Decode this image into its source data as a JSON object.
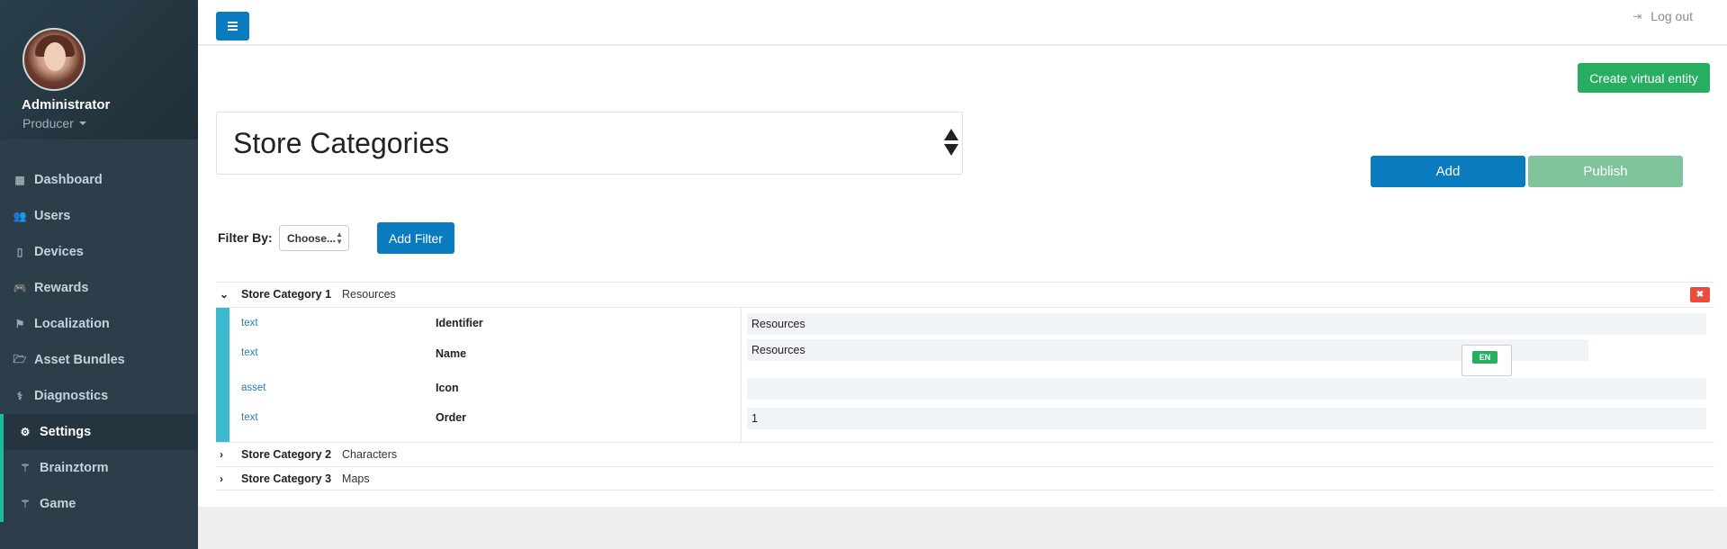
{
  "user": {
    "name": "Administrator",
    "role": "Producer"
  },
  "sidebar": {
    "items": [
      {
        "label": "Dashboard",
        "icon": "dashboard-icon"
      },
      {
        "label": "Users",
        "icon": "users-icon"
      },
      {
        "label": "Devices",
        "icon": "mobile-icon"
      },
      {
        "label": "Rewards",
        "icon": "gamepad-icon"
      },
      {
        "label": "Localization",
        "icon": "flag-icon"
      },
      {
        "label": "Asset Bundles",
        "icon": "folder-icon"
      },
      {
        "label": "Diagnostics",
        "icon": "stethoscope-icon"
      },
      {
        "label": "Settings",
        "icon": "cogs-icon"
      },
      {
        "label": "Brainztorm",
        "icon": "magic-wand-icon"
      },
      {
        "label": "Game",
        "icon": "magic-wand-icon"
      }
    ],
    "active": "Settings"
  },
  "topbar": {
    "logout_label": "Log out"
  },
  "actions": {
    "create_virtual_entity": "Create virtual entity",
    "add": "Add",
    "publish": "Publish"
  },
  "entity": {
    "selected": "Store Categories"
  },
  "filter": {
    "label": "Filter By:",
    "select_value": "Choose...",
    "add_button": "Add Filter"
  },
  "categories": [
    {
      "title": "Store Category 1",
      "value": "Resources",
      "expanded": true
    },
    {
      "title": "Store Category 2",
      "value": "Characters",
      "expanded": false
    },
    {
      "title": "Store Category 3",
      "value": "Maps",
      "expanded": false
    }
  ],
  "fields": [
    {
      "type": "text",
      "name": "Identifier",
      "value": "Resources"
    },
    {
      "type": "text",
      "name": "Name",
      "value": "Resources"
    },
    {
      "type": "asset",
      "name": "Icon",
      "value": ""
    },
    {
      "type": "text",
      "name": "Order",
      "value": "1"
    }
  ],
  "language_badge": "EN",
  "colors": {
    "sidebar": "#2b3e4a",
    "primary": "#0b7bc0",
    "success": "#27ae60",
    "accent": "#3bb9cf",
    "danger": "#e74c3c"
  }
}
